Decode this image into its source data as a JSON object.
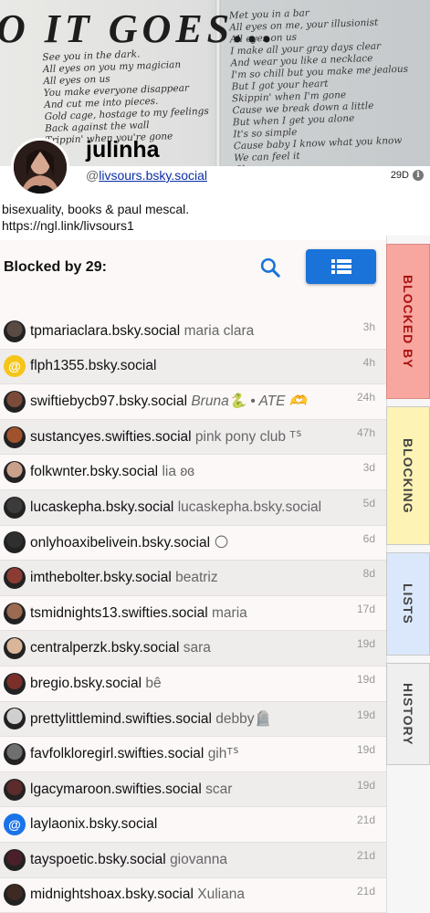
{
  "banner": {
    "title": "O IT GOES...",
    "lyrics_left": "See you in the dark.\nAll eyes on you my magician\nAll eyes on us\nYou make everyone disappear\nAnd cut me into pieces.\nGold cage, hostage to my feelings\nBack against the wall\nTrippin' when you're gone",
    "lyrics_right": "Met you in a bar\nAll eyes on me, your illusionist\nAll eyes on us\nI make all your gray days clear\nAnd wear you like a necklace\nI'm so chill but you make me jealous\nBut I got your heart\nSkippin' when I'm gone\nCause we break down a little\nBut when I get you alone\nIt's so simple\nCause baby I know what you know\nWe can feel it\nChorus\nCome here, dressed in black now"
  },
  "profile": {
    "display_name": "julinha",
    "handle_prefix": "@",
    "handle": "livsours.bsky.social",
    "age": "29D",
    "info_icon": "i",
    "bio_line1": "bisexuality, books & paul mescal.",
    "bio_line2": "https://ngl.link/livsours1"
  },
  "list": {
    "title": "Blocked by 29:",
    "rows": [
      {
        "handle": "tpmariaclara.bsky.social",
        "name": "maria clara",
        "time": "3h",
        "avatar": "#5a4a44",
        "italic": false
      },
      {
        "handle": "flph1355.bsky.social",
        "name": "",
        "time": "4h",
        "avatar": "#f5c518",
        "italic": false
      },
      {
        "handle": "swiftiebycb97.bsky.social",
        "name": "Bruna🐍 • ATE 🫶",
        "time": "24h",
        "avatar": "#7b4b3a",
        "italic": true
      },
      {
        "handle": "sustancyes.swifties.social",
        "name": "pink pony club ᵀᔆ",
        "time": "47h",
        "avatar": "#a0522d",
        "italic": false
      },
      {
        "handle": "folkwnter.bsky.social",
        "name": "lia ʚɞ",
        "time": "3d",
        "avatar": "#c9a08a",
        "italic": false
      },
      {
        "handle": "lucaskepha.bsky.social",
        "name": "lucaskepha.bsky.social",
        "time": "5d",
        "avatar": "#3b3b3b",
        "italic": false
      },
      {
        "handle": "onlyhoaxibelivein.bsky.social",
        "name": "🌕",
        "time": "6d",
        "avatar": "#2f2f2f",
        "italic": false
      },
      {
        "handle": "imthebolter.bsky.social",
        "name": "beatriz",
        "time": "8d",
        "avatar": "#8a3b32",
        "italic": false
      },
      {
        "handle": "tsmidnights13.swifties.social",
        "name": "maria",
        "time": "17d",
        "avatar": "#9b6a50",
        "italic": false
      },
      {
        "handle": "centralperzk.bsky.social",
        "name": "sara",
        "time": "19d",
        "avatar": "#d9b59a",
        "italic": false
      },
      {
        "handle": "bregio.bsky.social",
        "name": "bê",
        "time": "19d",
        "avatar": "#7a2f2a",
        "italic": false
      },
      {
        "handle": "prettylittlemind.swifties.social",
        "name": "debby🪦",
        "time": "19d",
        "avatar": "#cfcfcf",
        "italic": false
      },
      {
        "handle": "favfolkloregirl.swifties.social",
        "name": "gihᵀᔆ",
        "time": "19d",
        "avatar": "#6f6f6f",
        "italic": false
      },
      {
        "handle": "lgacymaroon.swifties.social",
        "name": "scar",
        "time": "19d",
        "avatar": "#5c2b2b",
        "italic": false
      },
      {
        "handle": "laylaonix.bsky.social",
        "name": "",
        "time": "21d",
        "avatar": "#1a73e8",
        "italic": false
      },
      {
        "handle": "tayspoetic.bsky.social",
        "name": "giovanna",
        "time": "21d",
        "avatar": "#4a1f2a",
        "italic": false
      },
      {
        "handle": "midnightshoax.bsky.social",
        "name": "Xuliana",
        "time": "21d",
        "avatar": "#3e2a22",
        "italic": false
      }
    ]
  },
  "tabs": {
    "blocked_by": "BLOCKED BY",
    "blocking": "BLOCKING",
    "lists": "LISTS",
    "history": "HISTORY"
  },
  "icons": {
    "search": "search-icon",
    "menu": "list-view-icon",
    "default_avatar": "at-sign-icon"
  },
  "colors": {
    "accent": "#1a73d9",
    "blocked_by_tab": "#f7a7a0",
    "blocking_tab": "#fdf3b5",
    "lists_tab": "#dbe8fb",
    "history_tab": "#efefef"
  }
}
